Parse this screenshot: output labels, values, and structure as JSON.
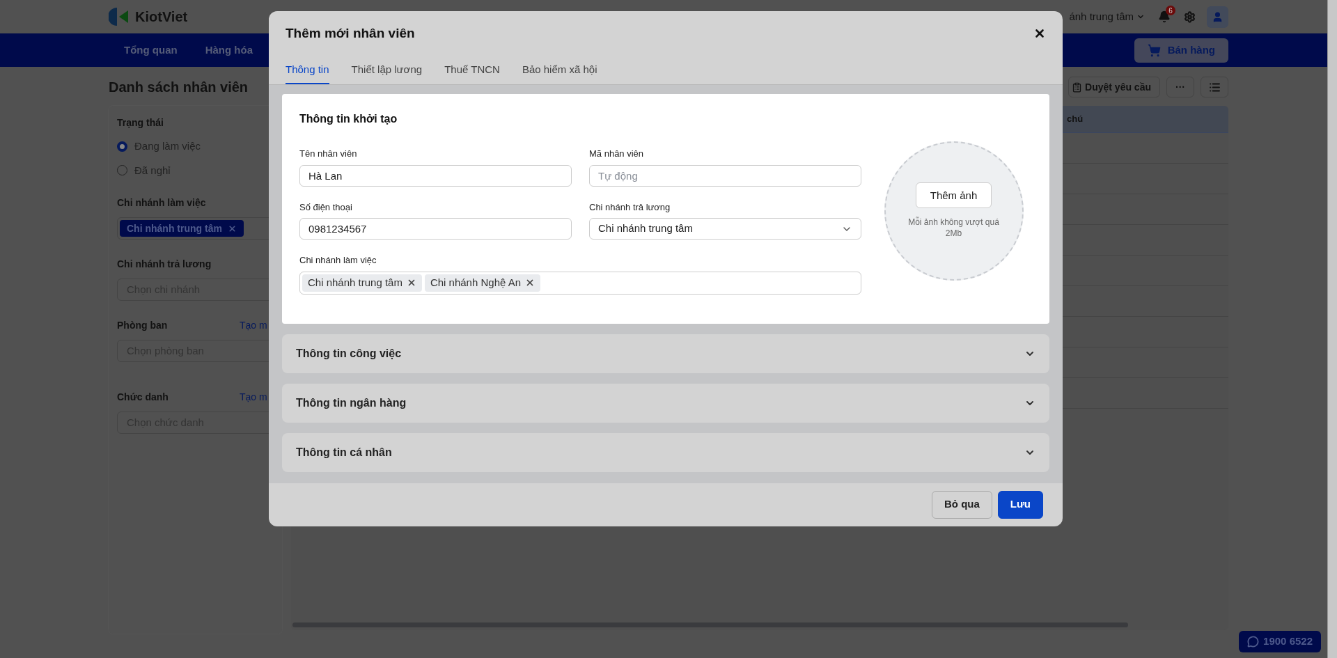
{
  "header": {
    "logo": "KiotViet",
    "branch": "ánh trung tâm",
    "notification_count": "6",
    "sell_button": "Bán hàng"
  },
  "nav": [
    {
      "label": "Tổng quan"
    },
    {
      "label": "Hàng hóa"
    }
  ],
  "page": {
    "title": "Danh sách nhân viên",
    "approve_button": "Duyệt yêu cầu",
    "more_button": "···"
  },
  "filters": {
    "status": {
      "title": "Trạng thái",
      "options": [
        {
          "label": "Đang làm việc",
          "selected": true
        },
        {
          "label": "Đã nghỉ",
          "selected": false
        }
      ]
    },
    "work_branch": {
      "title": "Chi nhánh làm việc",
      "tags": [
        "Chi nhánh trung tâm"
      ]
    },
    "pay_branch": {
      "title": "Chi nhánh trả lương",
      "placeholder": "Chọn chi nhánh"
    },
    "department": {
      "title": "Phòng ban",
      "link": "Tạo m",
      "placeholder": "Chọn phòng ban"
    },
    "position": {
      "title": "Chức danh",
      "link": "Tạo m",
      "placeholder": "Chọn chức danh"
    }
  },
  "table": {
    "columns": [
      "chú"
    ]
  },
  "support": {
    "phone": "1900 6522"
  },
  "modal": {
    "title": "Thêm mới nhân viên",
    "tabs": [
      {
        "label": "Thông tin",
        "selected": true
      },
      {
        "label": "Thiết lập lương",
        "selected": false
      },
      {
        "label": "Thuế TNCN",
        "selected": false
      },
      {
        "label": "Bảo hiểm xã hội",
        "selected": false
      }
    ],
    "section": {
      "title": "Thông tin khởi tạo",
      "fields": [
        {
          "kind": "text",
          "label": "Tên nhân viên",
          "value": "Hà Lan"
        },
        {
          "kind": "text",
          "label": "Mã nhân viên",
          "placeholder": "Tự động"
        },
        {
          "kind": "text",
          "label": "Số điện thoại",
          "value": "0981234567"
        },
        {
          "kind": "select",
          "label": "Chi nhánh trả lương",
          "value": "Chi nhánh trung tâm"
        },
        {
          "kind": "tags",
          "label": "Chi nhánh làm việc",
          "tags": [
            "Chi nhánh trung tâm",
            "Chi nhánh Nghệ An"
          ]
        }
      ],
      "photo": {
        "button": "Thêm ảnh",
        "hint": "Mỗi ảnh không vượt quá 2Mb"
      }
    },
    "accordions": [
      {
        "title": "Thông tin công việc",
        "expanded": false
      },
      {
        "title": "Thông tin ngân hàng",
        "expanded": false
      },
      {
        "title": "Thông tin cá nhân",
        "expanded": false
      }
    ],
    "buttons": [
      {
        "label": "Bỏ qua",
        "kind": "secondary"
      },
      {
        "label": "Lưu",
        "kind": "primary"
      }
    ]
  }
}
